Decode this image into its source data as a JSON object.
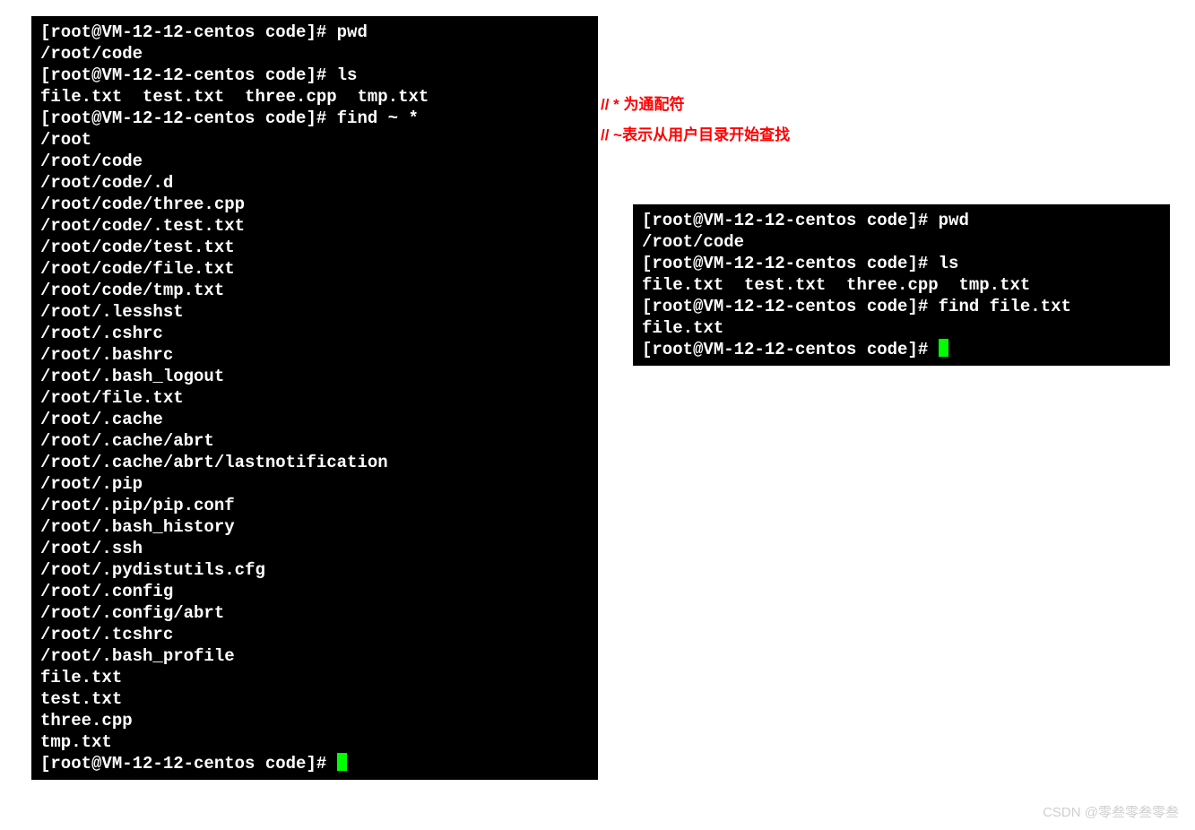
{
  "terminalLeft": {
    "prompt": "[root@VM-12-12-centos code]#",
    "lines": [
      "[root@VM-12-12-centos code]# pwd",
      "/root/code",
      "[root@VM-12-12-centos code]# ls",
      "file.txt  test.txt  three.cpp  tmp.txt",
      "[root@VM-12-12-centos code]# find ~ *",
      "/root",
      "/root/code",
      "/root/code/.d",
      "/root/code/three.cpp",
      "/root/code/.test.txt",
      "/root/code/test.txt",
      "/root/code/file.txt",
      "/root/code/tmp.txt",
      "/root/.lesshst",
      "/root/.cshrc",
      "/root/.bashrc",
      "/root/.bash_logout",
      "/root/file.txt",
      "/root/.cache",
      "/root/.cache/abrt",
      "/root/.cache/abrt/lastnotification",
      "/root/.pip",
      "/root/.pip/pip.conf",
      "/root/.bash_history",
      "/root/.ssh",
      "/root/.pydistutils.cfg",
      "/root/.config",
      "/root/.config/abrt",
      "/root/.tcshrc",
      "/root/.bash_profile",
      "file.txt",
      "test.txt",
      "three.cpp",
      "tmp.txt"
    ],
    "lastPrompt": "[root@VM-12-12-centos code]# "
  },
  "annotations": {
    "line1": "// * 为通配符",
    "line2": "// ~表示从用户目录开始查找"
  },
  "terminalRight": {
    "lines": [
      "[root@VM-12-12-centos code]# pwd",
      "/root/code",
      "[root@VM-12-12-centos code]# ls",
      "file.txt  test.txt  three.cpp  tmp.txt",
      "[root@VM-12-12-centos code]# find file.txt",
      "file.txt"
    ],
    "lastPrompt": "[root@VM-12-12-centos code]# "
  },
  "watermark": "CSDN @零叁零叁零叁"
}
